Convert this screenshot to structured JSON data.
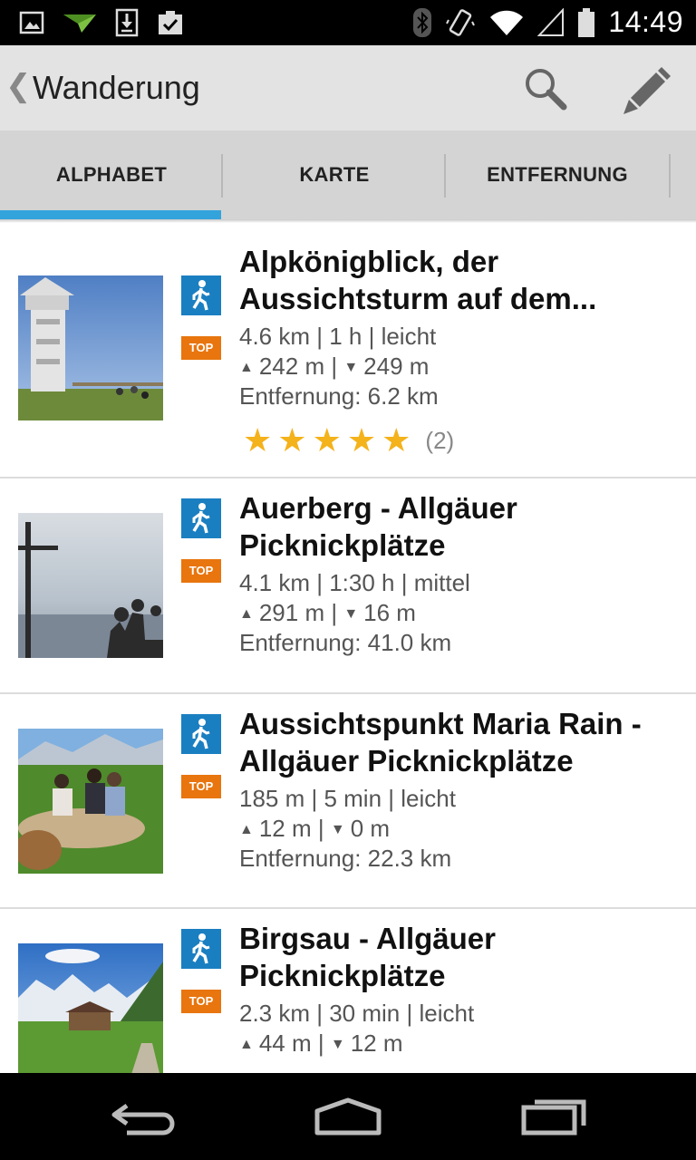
{
  "status_bar": {
    "time": "14:49",
    "left_icons": [
      "image-icon",
      "send-icon",
      "download-icon",
      "clipboard-check-icon"
    ],
    "right_icons": [
      "bluetooth-icon",
      "vibrate-icon",
      "wifi-icon",
      "signal-icon",
      "battery-icon"
    ]
  },
  "action_bar": {
    "title": "Wanderung",
    "back_glyph": "❮",
    "icons": [
      "search-icon",
      "edit-pencil-icon"
    ]
  },
  "tabs": [
    {
      "label": "ALPHABET",
      "active": true
    },
    {
      "label": "KARTE",
      "active": false
    },
    {
      "label": "ENTFERNUNG",
      "active": false
    }
  ],
  "colors": {
    "accent": "#33a3dc",
    "hike_icon": "#1a7fc1",
    "top_badge": "#e8750e",
    "star": "#f4b21b"
  },
  "list": {
    "items": [
      {
        "title": "Alpkönigblick, der Aussichtsturm auf dem...",
        "stats": "4.6 km | 1 h | leicht",
        "ascent": "242 m",
        "descent": "249 m",
        "distance": "Entfernung: 6.2 km",
        "badge": "TOP",
        "rating": 5,
        "rating_count": "(2)"
      },
      {
        "title": "Auerberg - Allgäuer Picknickplätze",
        "stats": "4.1 km | 1:30 h | mittel",
        "ascent": "291 m",
        "descent": "16 m",
        "distance": "Entfernung: 41.0 km",
        "badge": "TOP"
      },
      {
        "title": "Aussichtspunkt Maria Rain - Allgäuer Picknickplätze",
        "stats": "185 m | 5 min | leicht",
        "ascent": "12 m",
        "descent": "0 m",
        "distance": "Entfernung: 22.3 km",
        "badge": "TOP"
      },
      {
        "title": "Birgsau - Allgäuer Picknickplätze",
        "stats": "2.3 km | 30 min | leicht",
        "ascent": "44 m",
        "descent": "12 m",
        "badge": "TOP"
      }
    ],
    "separator": " | ",
    "up_glyph": "▲",
    "down_glyph": "▼",
    "star_glyph": "★"
  },
  "nav_bar": {
    "icons": [
      "back-icon",
      "home-icon",
      "recent-apps-icon"
    ]
  }
}
